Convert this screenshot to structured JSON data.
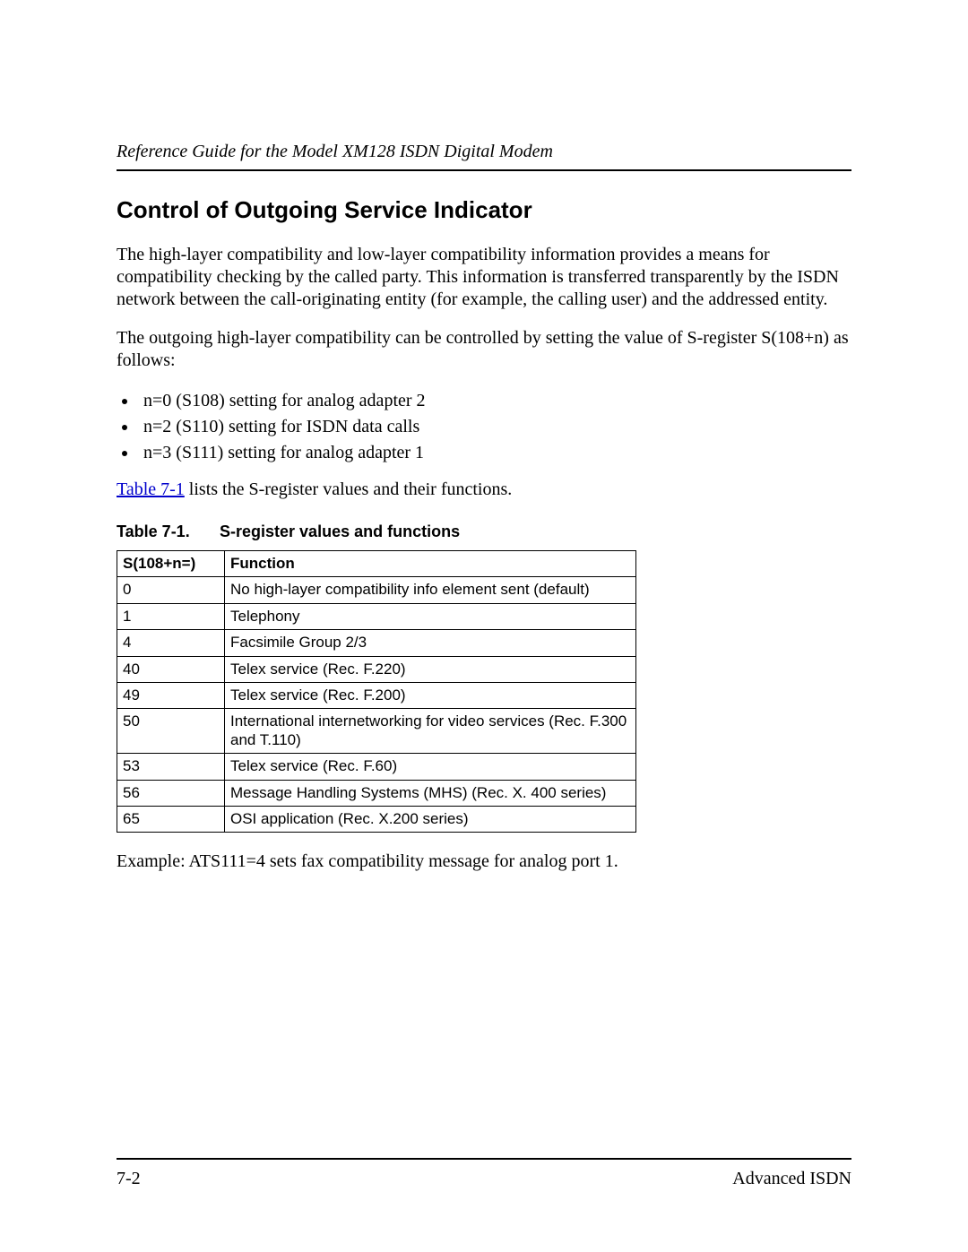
{
  "header": {
    "running_title": "Reference Guide for the Model XM128 ISDN Digital Modem"
  },
  "section": {
    "title": "Control of Outgoing Service Indicator",
    "para1": "The high-layer compatibility and low-layer compatibility information provides a means for compatibility checking by the called party. This information is transferred transparently by the ISDN network between the call-originating entity (for example, the calling user) and the addressed entity.",
    "para2": "The outgoing high-layer compatibility can be controlled by setting the value of S-register S(108+n) as follows:",
    "bullets": [
      "n=0 (S108) setting for analog adapter 2",
      "n=2 (S110) setting for ISDN data calls",
      "n=3 (S111) setting for analog adapter 1"
    ],
    "ref_sentence": {
      "link_text": "Table 7-1",
      "rest": " lists the S-register values and their functions."
    },
    "table": {
      "caption_label": "Table 7-1.",
      "caption_title": "S-register values and functions",
      "headers": {
        "col1": "S(108+n=)",
        "col2": "Function"
      },
      "rows": [
        {
          "v": "0",
          "f": "No high-layer compatibility info element sent (default)"
        },
        {
          "v": "1",
          "f": "Telephony"
        },
        {
          "v": "4",
          "f": "Facsimile Group 2/3"
        },
        {
          "v": "40",
          "f": "Telex service (Rec. F.220)"
        },
        {
          "v": "49",
          "f": "Telex service (Rec. F.200)"
        },
        {
          "v": "50",
          "f": "International internetworking for video services (Rec. F.300 and T.110)"
        },
        {
          "v": "53",
          "f": "Telex service (Rec. F.60)"
        },
        {
          "v": "56",
          "f": "Message Handling Systems (MHS) (Rec. X. 400 series)"
        },
        {
          "v": "65",
          "f": "OSI application (Rec. X.200 series)"
        }
      ]
    },
    "example": "Example: ATS111=4 sets fax compatibility message for analog port 1."
  },
  "footer": {
    "page_number": "7-2",
    "section_name": "Advanced ISDN"
  }
}
